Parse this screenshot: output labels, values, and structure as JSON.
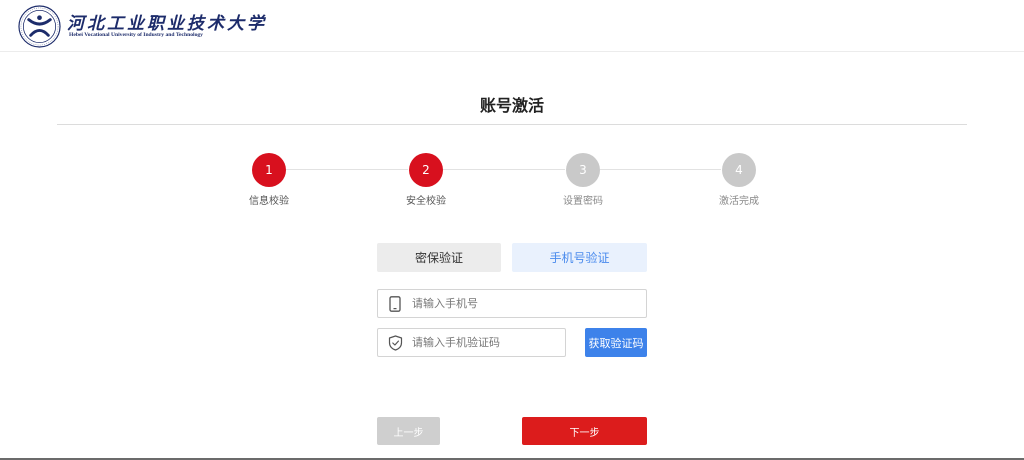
{
  "header": {
    "logo_cn": "河北工业职业技术大学",
    "logo_en": "Hebei Vocational University of Industry and Technology",
    "emblem_icon": "university-emblem-icon"
  },
  "page": {
    "title": "账号激活"
  },
  "steps": [
    {
      "number": "1",
      "label": "信息校验",
      "state": "completed"
    },
    {
      "number": "2",
      "label": "安全校验",
      "state": "active"
    },
    {
      "number": "3",
      "label": "设置密码",
      "state": "inactive"
    },
    {
      "number": "4",
      "label": "激活完成",
      "state": "inactive"
    }
  ],
  "verify_tabs": {
    "security_question": "密保验证",
    "phone": "手机号验证",
    "selected": "手机号验证"
  },
  "form": {
    "phone_placeholder": "请输入手机号",
    "phone_value": "",
    "phone_icon": "mobile-phone-icon",
    "code_placeholder": "请输入手机验证码",
    "code_value": "",
    "code_icon": "shield-check-icon",
    "get_code_label": "获取验证码"
  },
  "actions": {
    "prev_label": "上一步",
    "next_label": "下一步"
  },
  "colors": {
    "accent_red": "#d8101e",
    "inactive_gray": "#c9c9c9",
    "link_blue": "#3d82ea",
    "tab_active_bg": "#e9f1fd"
  }
}
